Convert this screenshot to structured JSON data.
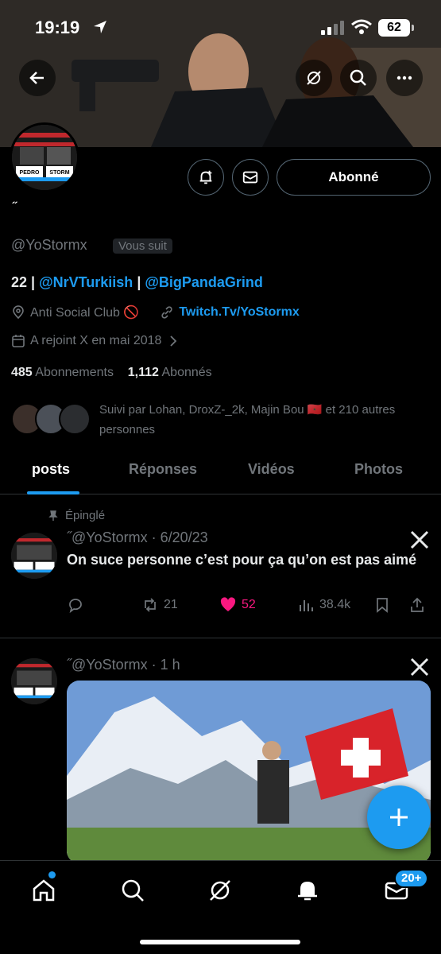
{
  "status_bar": {
    "time": "19:19",
    "battery": "62"
  },
  "profile": {
    "display_name": "˝",
    "handle": "@YoStormx",
    "follows_you": "Vous suit",
    "follow_button": "Abonné",
    "bio": {
      "prefix": "22 | ",
      "mention1": "@NrVTurkiish",
      "sep": " | ",
      "mention2": "@BigPandaGrind"
    },
    "location": "Anti Social Club 🚫",
    "website": "Twitch.Tv/YoStormx",
    "joined": "A rejoint X en mai 2018",
    "following_count": "485",
    "following_label": "Abonnements",
    "followers_count": "1,112",
    "followers_label": "Abonnés",
    "followed_by": "Suivi par Lohan, DroxZ-_2k, Majin Bou 🇲🇦 et 210 autres personnes"
  },
  "tabs": [
    {
      "label": "posts",
      "active": true
    },
    {
      "label": "Réponses",
      "active": false
    },
    {
      "label": "Vidéos",
      "active": false
    },
    {
      "label": "Photos",
      "active": false
    }
  ],
  "posts": [
    {
      "pinned_label": "Épinglé",
      "header": "˝@YoStormx · 6/20/23",
      "text": "On suce personne c’est pour ça qu’on est pas aimé",
      "reposts": "21",
      "likes": "52",
      "views": "38.4k",
      "liked": true
    },
    {
      "header": "˝@YoStormx · 1 h"
    }
  ],
  "nav": {
    "messages_badge": "20+"
  },
  "colors": {
    "accent": "#1d9bf0",
    "like": "#f91880",
    "muted": "#71767b",
    "background": "#000000"
  },
  "icons": [
    "back-arrow-icon",
    "grok-icon",
    "search-icon",
    "more-icon",
    "bell-plus-icon",
    "mail-icon",
    "location-icon",
    "link-icon",
    "calendar-icon",
    "pin-icon",
    "x-logo-icon",
    "reply-icon",
    "repost-icon",
    "heart-icon",
    "views-icon",
    "bookmark-icon",
    "share-icon",
    "plus-icon",
    "home-icon",
    "bell-icon"
  ]
}
